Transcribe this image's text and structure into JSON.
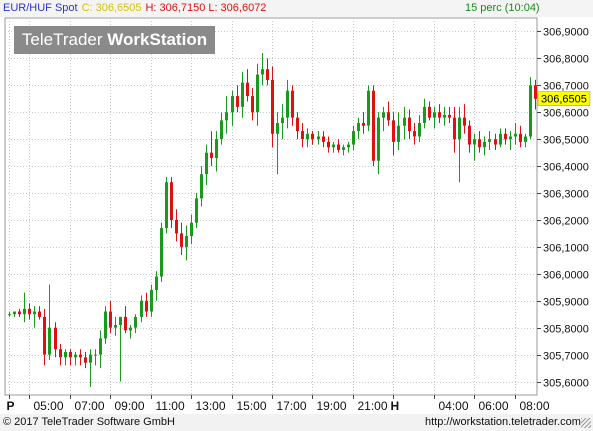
{
  "header": {
    "symbol": "EUR/HUF Spot",
    "close_label": "C:",
    "close_value": "306,6505",
    "high_label": "H:",
    "high_value": "306,7150",
    "low_label": "L:",
    "low_value": "306,6072",
    "interval": "15 perc (10:04)"
  },
  "watermark": {
    "part1": "TeleTrader",
    "part2": "WorkStation"
  },
  "footer": {
    "copyright": "© 2017 TeleTrader Software GmbH",
    "url": "http://workstation.teletrader.com"
  },
  "colors": {
    "up": "#1a9a1a",
    "down": "#dd1111",
    "price_tag": "#ffff00",
    "header_close": "#d4c200"
  },
  "chart_data": {
    "type": "candlestick",
    "symbol": "EUR/HUF Spot",
    "interval": "15 perc",
    "last_price": "306,6505",
    "ylim": [
      305.55,
      306.95
    ],
    "y_ticks": [
      "306,9000",
      "306,8000",
      "306,7000",
      "306,6000",
      "306,5000",
      "306,4000",
      "306,3000",
      "306,2000",
      "306,1000",
      "306,0000",
      "305,9000",
      "305,8000",
      "305,7000",
      "305,6000"
    ],
    "x_ticks": [
      {
        "label": "P",
        "bar": 0,
        "bold": true
      },
      {
        "label": "05:00",
        "bar": 4
      },
      {
        "label": "07:00",
        "bar": 12
      },
      {
        "label": "09:00",
        "bar": 20
      },
      {
        "label": "11:00",
        "bar": 28
      },
      {
        "label": "13:00",
        "bar": 36
      },
      {
        "label": "15:00",
        "bar": 44
      },
      {
        "label": "17:00",
        "bar": 52
      },
      {
        "label": "19:00",
        "bar": 60
      },
      {
        "label": "21:00",
        "bar": 68
      },
      {
        "label": "H",
        "bar": 76,
        "bold": true
      },
      {
        "label": "04:00",
        "bar": 84
      },
      {
        "label": "06:00",
        "bar": 92
      },
      {
        "label": "08:00",
        "bar": 100
      }
    ],
    "grid": true,
    "bar_count": 105,
    "candles": [
      [
        305.85,
        305.86,
        305.84,
        305.85
      ],
      [
        305.85,
        305.86,
        305.84,
        305.86
      ],
      [
        305.86,
        305.87,
        305.84,
        305.85
      ],
      [
        305.85,
        305.93,
        305.82,
        305.87
      ],
      [
        305.87,
        305.89,
        305.83,
        305.85
      ],
      [
        305.85,
        305.88,
        305.8,
        305.86
      ],
      [
        305.86,
        305.88,
        305.83,
        305.84
      ],
      [
        305.84,
        305.87,
        305.66,
        305.7
      ],
      [
        305.7,
        305.96,
        305.68,
        305.8
      ],
      [
        305.8,
        305.82,
        305.69,
        305.72
      ],
      [
        305.72,
        305.74,
        305.66,
        305.69
      ],
      [
        305.69,
        305.72,
        305.66,
        305.71
      ],
      [
        305.71,
        305.72,
        305.66,
        305.69
      ],
      [
        305.69,
        305.71,
        305.66,
        305.7
      ],
      [
        305.7,
        305.72,
        305.66,
        305.69
      ],
      [
        305.69,
        305.71,
        305.65,
        305.67
      ],
      [
        305.67,
        305.72,
        305.58,
        305.7
      ],
      [
        305.7,
        305.72,
        305.66,
        305.7
      ],
      [
        305.7,
        305.79,
        305.65,
        305.76
      ],
      [
        305.76,
        305.88,
        305.74,
        305.86
      ],
      [
        305.86,
        305.9,
        305.78,
        305.8
      ],
      [
        305.8,
        305.84,
        305.77,
        305.81
      ],
      [
        305.81,
        305.82,
        305.6,
        305.84
      ],
      [
        305.84,
        305.88,
        305.78,
        305.79
      ],
      [
        305.79,
        305.81,
        305.76,
        305.8
      ],
      [
        305.8,
        305.85,
        305.78,
        305.84
      ],
      [
        305.84,
        305.92,
        305.82,
        305.9
      ],
      [
        305.9,
        305.93,
        305.84,
        305.86
      ],
      [
        305.86,
        305.96,
        305.84,
        305.94
      ],
      [
        305.94,
        306.01,
        305.9,
        305.99
      ],
      [
        305.99,
        306.19,
        305.97,
        306.17
      ],
      [
        306.17,
        306.36,
        306.15,
        306.34
      ],
      [
        306.34,
        306.36,
        306.17,
        306.2
      ],
      [
        306.2,
        306.24,
        306.12,
        306.15
      ],
      [
        306.15,
        306.19,
        306.07,
        306.1
      ],
      [
        306.1,
        306.18,
        306.05,
        306.14
      ],
      [
        306.14,
        306.22,
        306.11,
        306.19
      ],
      [
        306.19,
        306.3,
        306.17,
        306.28
      ],
      [
        306.28,
        306.4,
        306.25,
        306.37
      ],
      [
        306.37,
        306.48,
        306.33,
        306.45
      ],
      [
        306.45,
        306.53,
        306.4,
        306.43
      ],
      [
        306.43,
        306.53,
        306.38,
        306.5
      ],
      [
        306.5,
        306.6,
        306.48,
        306.57
      ],
      [
        306.57,
        306.66,
        306.52,
        306.6
      ],
      [
        306.6,
        306.68,
        306.55,
        306.66
      ],
      [
        306.66,
        306.7,
        306.6,
        306.62
      ],
      [
        306.62,
        306.75,
        306.58,
        306.71
      ],
      [
        306.71,
        306.76,
        306.64,
        306.66
      ],
      [
        306.66,
        306.69,
        306.57,
        306.6
      ],
      [
        306.6,
        306.78,
        306.55,
        306.74
      ],
      [
        306.74,
        306.82,
        306.7,
        306.76
      ],
      [
        306.76,
        306.8,
        306.7,
        306.72
      ],
      [
        306.72,
        306.77,
        306.47,
        306.52
      ],
      [
        306.52,
        306.6,
        306.37,
        306.56
      ],
      [
        306.56,
        306.63,
        306.5,
        306.58
      ],
      [
        306.58,
        306.72,
        306.54,
        306.68
      ],
      [
        306.68,
        306.7,
        306.55,
        306.58
      ],
      [
        306.58,
        306.6,
        306.5,
        306.53
      ],
      [
        306.53,
        306.56,
        306.47,
        306.5
      ],
      [
        306.5,
        306.54,
        306.47,
        306.52
      ],
      [
        306.52,
        306.53,
        306.48,
        306.5
      ],
      [
        306.5,
        306.53,
        306.48,
        306.51
      ],
      [
        306.51,
        306.53,
        306.47,
        306.49
      ],
      [
        306.49,
        306.51,
        306.45,
        306.47
      ],
      [
        306.47,
        306.49,
        306.45,
        306.48
      ],
      [
        306.48,
        306.5,
        306.45,
        306.46
      ],
      [
        306.46,
        306.48,
        306.44,
        306.47
      ],
      [
        306.47,
        306.49,
        306.45,
        306.48
      ],
      [
        306.48,
        306.55,
        306.46,
        306.53
      ],
      [
        306.53,
        306.58,
        306.5,
        306.56
      ],
      [
        306.56,
        306.6,
        306.52,
        306.55
      ],
      [
        306.55,
        306.7,
        306.53,
        306.68
      ],
      [
        306.68,
        306.7,
        306.4,
        306.42
      ],
      [
        306.42,
        306.6,
        306.37,
        306.58
      ],
      [
        306.58,
        306.62,
        306.53,
        306.6
      ],
      [
        306.6,
        306.64,
        306.55,
        306.57
      ],
      [
        306.57,
        306.6,
        306.44,
        306.49
      ],
      [
        306.49,
        306.6,
        306.46,
        306.55
      ],
      [
        306.55,
        306.62,
        306.5,
        306.58
      ],
      [
        306.58,
        306.61,
        306.5,
        306.53
      ],
      [
        306.53,
        306.56,
        306.48,
        306.51
      ],
      [
        306.51,
        306.59,
        306.49,
        306.56
      ],
      [
        306.56,
        306.65,
        306.54,
        306.62
      ],
      [
        306.62,
        306.64,
        306.57,
        306.58
      ],
      [
        306.58,
        306.62,
        306.54,
        306.6
      ],
      [
        306.6,
        306.63,
        306.56,
        306.58
      ],
      [
        306.58,
        306.62,
        306.55,
        306.59
      ],
      [
        306.59,
        306.62,
        306.56,
        306.58
      ],
      [
        306.58,
        306.62,
        306.45,
        306.5
      ],
      [
        306.5,
        306.62,
        306.34,
        306.58
      ],
      [
        306.58,
        306.63,
        306.52,
        306.55
      ],
      [
        306.55,
        306.57,
        306.45,
        306.48
      ],
      [
        306.48,
        306.52,
        306.42,
        306.5
      ],
      [
        306.5,
        306.53,
        306.45,
        306.47
      ],
      [
        306.47,
        306.51,
        306.44,
        306.49
      ],
      [
        306.49,
        306.53,
        306.46,
        306.5
      ],
      [
        306.5,
        306.52,
        306.46,
        306.48
      ],
      [
        306.48,
        306.54,
        306.47,
        306.52
      ],
      [
        306.52,
        306.54,
        306.48,
        306.5
      ],
      [
        306.5,
        306.53,
        306.46,
        306.51
      ],
      [
        306.51,
        306.56,
        306.48,
        306.52
      ],
      [
        306.52,
        306.55,
        306.47,
        306.49
      ],
      [
        306.49,
        306.52,
        306.47,
        306.51
      ],
      [
        306.51,
        306.73,
        306.5,
        306.7
      ],
      [
        306.7,
        306.72,
        306.61,
        306.65
      ]
    ]
  }
}
